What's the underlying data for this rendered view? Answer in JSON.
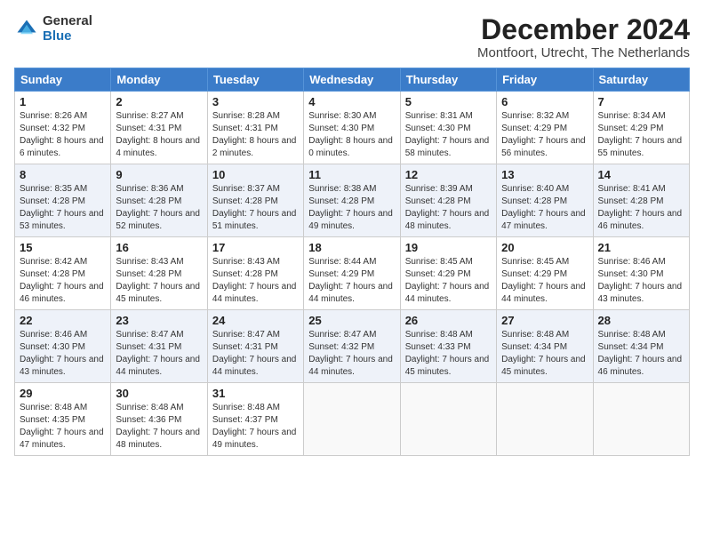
{
  "header": {
    "logo_general": "General",
    "logo_blue": "Blue",
    "month_title": "December 2024",
    "location": "Montfoort, Utrecht, The Netherlands"
  },
  "weekdays": [
    "Sunday",
    "Monday",
    "Tuesday",
    "Wednesday",
    "Thursday",
    "Friday",
    "Saturday"
  ],
  "weeks": [
    [
      {
        "day": "1",
        "sunrise": "Sunrise: 8:26 AM",
        "sunset": "Sunset: 4:32 PM",
        "daylight": "Daylight: 8 hours and 6 minutes."
      },
      {
        "day": "2",
        "sunrise": "Sunrise: 8:27 AM",
        "sunset": "Sunset: 4:31 PM",
        "daylight": "Daylight: 8 hours and 4 minutes."
      },
      {
        "day": "3",
        "sunrise": "Sunrise: 8:28 AM",
        "sunset": "Sunset: 4:31 PM",
        "daylight": "Daylight: 8 hours and 2 minutes."
      },
      {
        "day": "4",
        "sunrise": "Sunrise: 8:30 AM",
        "sunset": "Sunset: 4:30 PM",
        "daylight": "Daylight: 8 hours and 0 minutes."
      },
      {
        "day": "5",
        "sunrise": "Sunrise: 8:31 AM",
        "sunset": "Sunset: 4:30 PM",
        "daylight": "Daylight: 7 hours and 58 minutes."
      },
      {
        "day": "6",
        "sunrise": "Sunrise: 8:32 AM",
        "sunset": "Sunset: 4:29 PM",
        "daylight": "Daylight: 7 hours and 56 minutes."
      },
      {
        "day": "7",
        "sunrise": "Sunrise: 8:34 AM",
        "sunset": "Sunset: 4:29 PM",
        "daylight": "Daylight: 7 hours and 55 minutes."
      }
    ],
    [
      {
        "day": "8",
        "sunrise": "Sunrise: 8:35 AM",
        "sunset": "Sunset: 4:28 PM",
        "daylight": "Daylight: 7 hours and 53 minutes."
      },
      {
        "day": "9",
        "sunrise": "Sunrise: 8:36 AM",
        "sunset": "Sunset: 4:28 PM",
        "daylight": "Daylight: 7 hours and 52 minutes."
      },
      {
        "day": "10",
        "sunrise": "Sunrise: 8:37 AM",
        "sunset": "Sunset: 4:28 PM",
        "daylight": "Daylight: 7 hours and 51 minutes."
      },
      {
        "day": "11",
        "sunrise": "Sunrise: 8:38 AM",
        "sunset": "Sunset: 4:28 PM",
        "daylight": "Daylight: 7 hours and 49 minutes."
      },
      {
        "day": "12",
        "sunrise": "Sunrise: 8:39 AM",
        "sunset": "Sunset: 4:28 PM",
        "daylight": "Daylight: 7 hours and 48 minutes."
      },
      {
        "day": "13",
        "sunrise": "Sunrise: 8:40 AM",
        "sunset": "Sunset: 4:28 PM",
        "daylight": "Daylight: 7 hours and 47 minutes."
      },
      {
        "day": "14",
        "sunrise": "Sunrise: 8:41 AM",
        "sunset": "Sunset: 4:28 PM",
        "daylight": "Daylight: 7 hours and 46 minutes."
      }
    ],
    [
      {
        "day": "15",
        "sunrise": "Sunrise: 8:42 AM",
        "sunset": "Sunset: 4:28 PM",
        "daylight": "Daylight: 7 hours and 46 minutes."
      },
      {
        "day": "16",
        "sunrise": "Sunrise: 8:43 AM",
        "sunset": "Sunset: 4:28 PM",
        "daylight": "Daylight: 7 hours and 45 minutes."
      },
      {
        "day": "17",
        "sunrise": "Sunrise: 8:43 AM",
        "sunset": "Sunset: 4:28 PM",
        "daylight": "Daylight: 7 hours and 44 minutes."
      },
      {
        "day": "18",
        "sunrise": "Sunrise: 8:44 AM",
        "sunset": "Sunset: 4:29 PM",
        "daylight": "Daylight: 7 hours and 44 minutes."
      },
      {
        "day": "19",
        "sunrise": "Sunrise: 8:45 AM",
        "sunset": "Sunset: 4:29 PM",
        "daylight": "Daylight: 7 hours and 44 minutes."
      },
      {
        "day": "20",
        "sunrise": "Sunrise: 8:45 AM",
        "sunset": "Sunset: 4:29 PM",
        "daylight": "Daylight: 7 hours and 44 minutes."
      },
      {
        "day": "21",
        "sunrise": "Sunrise: 8:46 AM",
        "sunset": "Sunset: 4:30 PM",
        "daylight": "Daylight: 7 hours and 43 minutes."
      }
    ],
    [
      {
        "day": "22",
        "sunrise": "Sunrise: 8:46 AM",
        "sunset": "Sunset: 4:30 PM",
        "daylight": "Daylight: 7 hours and 43 minutes."
      },
      {
        "day": "23",
        "sunrise": "Sunrise: 8:47 AM",
        "sunset": "Sunset: 4:31 PM",
        "daylight": "Daylight: 7 hours and 44 minutes."
      },
      {
        "day": "24",
        "sunrise": "Sunrise: 8:47 AM",
        "sunset": "Sunset: 4:31 PM",
        "daylight": "Daylight: 7 hours and 44 minutes."
      },
      {
        "day": "25",
        "sunrise": "Sunrise: 8:47 AM",
        "sunset": "Sunset: 4:32 PM",
        "daylight": "Daylight: 7 hours and 44 minutes."
      },
      {
        "day": "26",
        "sunrise": "Sunrise: 8:48 AM",
        "sunset": "Sunset: 4:33 PM",
        "daylight": "Daylight: 7 hours and 45 minutes."
      },
      {
        "day": "27",
        "sunrise": "Sunrise: 8:48 AM",
        "sunset": "Sunset: 4:34 PM",
        "daylight": "Daylight: 7 hours and 45 minutes."
      },
      {
        "day": "28",
        "sunrise": "Sunrise: 8:48 AM",
        "sunset": "Sunset: 4:34 PM",
        "daylight": "Daylight: 7 hours and 46 minutes."
      }
    ],
    [
      {
        "day": "29",
        "sunrise": "Sunrise: 8:48 AM",
        "sunset": "Sunset: 4:35 PM",
        "daylight": "Daylight: 7 hours and 47 minutes."
      },
      {
        "day": "30",
        "sunrise": "Sunrise: 8:48 AM",
        "sunset": "Sunset: 4:36 PM",
        "daylight": "Daylight: 7 hours and 48 minutes."
      },
      {
        "day": "31",
        "sunrise": "Sunrise: 8:48 AM",
        "sunset": "Sunset: 4:37 PM",
        "daylight": "Daylight: 7 hours and 49 minutes."
      },
      null,
      null,
      null,
      null
    ]
  ]
}
